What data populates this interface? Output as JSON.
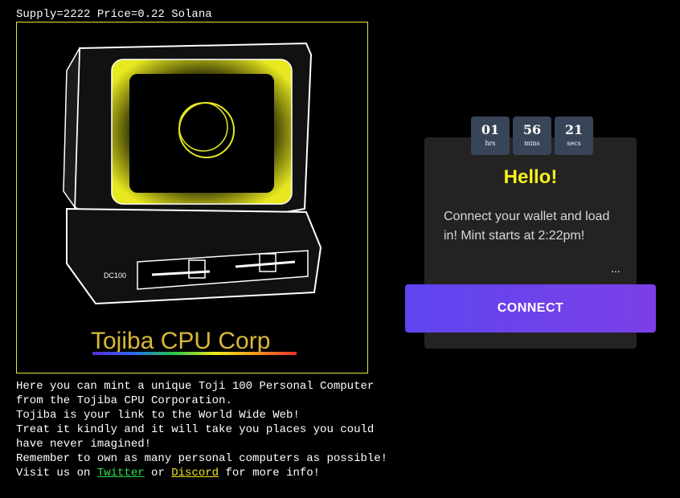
{
  "supply_line": "Supply=2222 Price=0.22 Solana",
  "artwork": {
    "logo_text": "Tojiba CPU Corp",
    "badge_text": "DC100",
    "frame_color": "#e6e63a"
  },
  "description": {
    "lines": [
      "Here you can mint a unique Toji 100 Personal Computer",
      "from the Tojiba CPU Corporation.",
      "Tojiba is your link to the World Wide Web!",
      "Treat it kindly and it will take you places you could",
      "have never imagined!",
      "Remember to own as many personal computers as possible!"
    ],
    "visit_prefix": "Visit us on ",
    "twitter_link": "Twitter",
    "visit_or": " or ",
    "discord_link": "Discord",
    "visit_suffix": " for more info!"
  },
  "countdown": {
    "hours": "01",
    "hours_label": "hrs",
    "mins": "56",
    "mins_label": "mins",
    "secs": "21",
    "secs_label": "secs"
  },
  "panel": {
    "title": "Hello!",
    "message": "Connect your wallet and load in! Mint starts at 2:22pm!",
    "dots": "...",
    "connect_label": "CONNECT"
  },
  "colors": {
    "accent_yellow": "#f7f21a",
    "button_purple": "#6a43ec",
    "twitter_green": "#2be04a",
    "discord_yellow": "#f1e51f"
  }
}
